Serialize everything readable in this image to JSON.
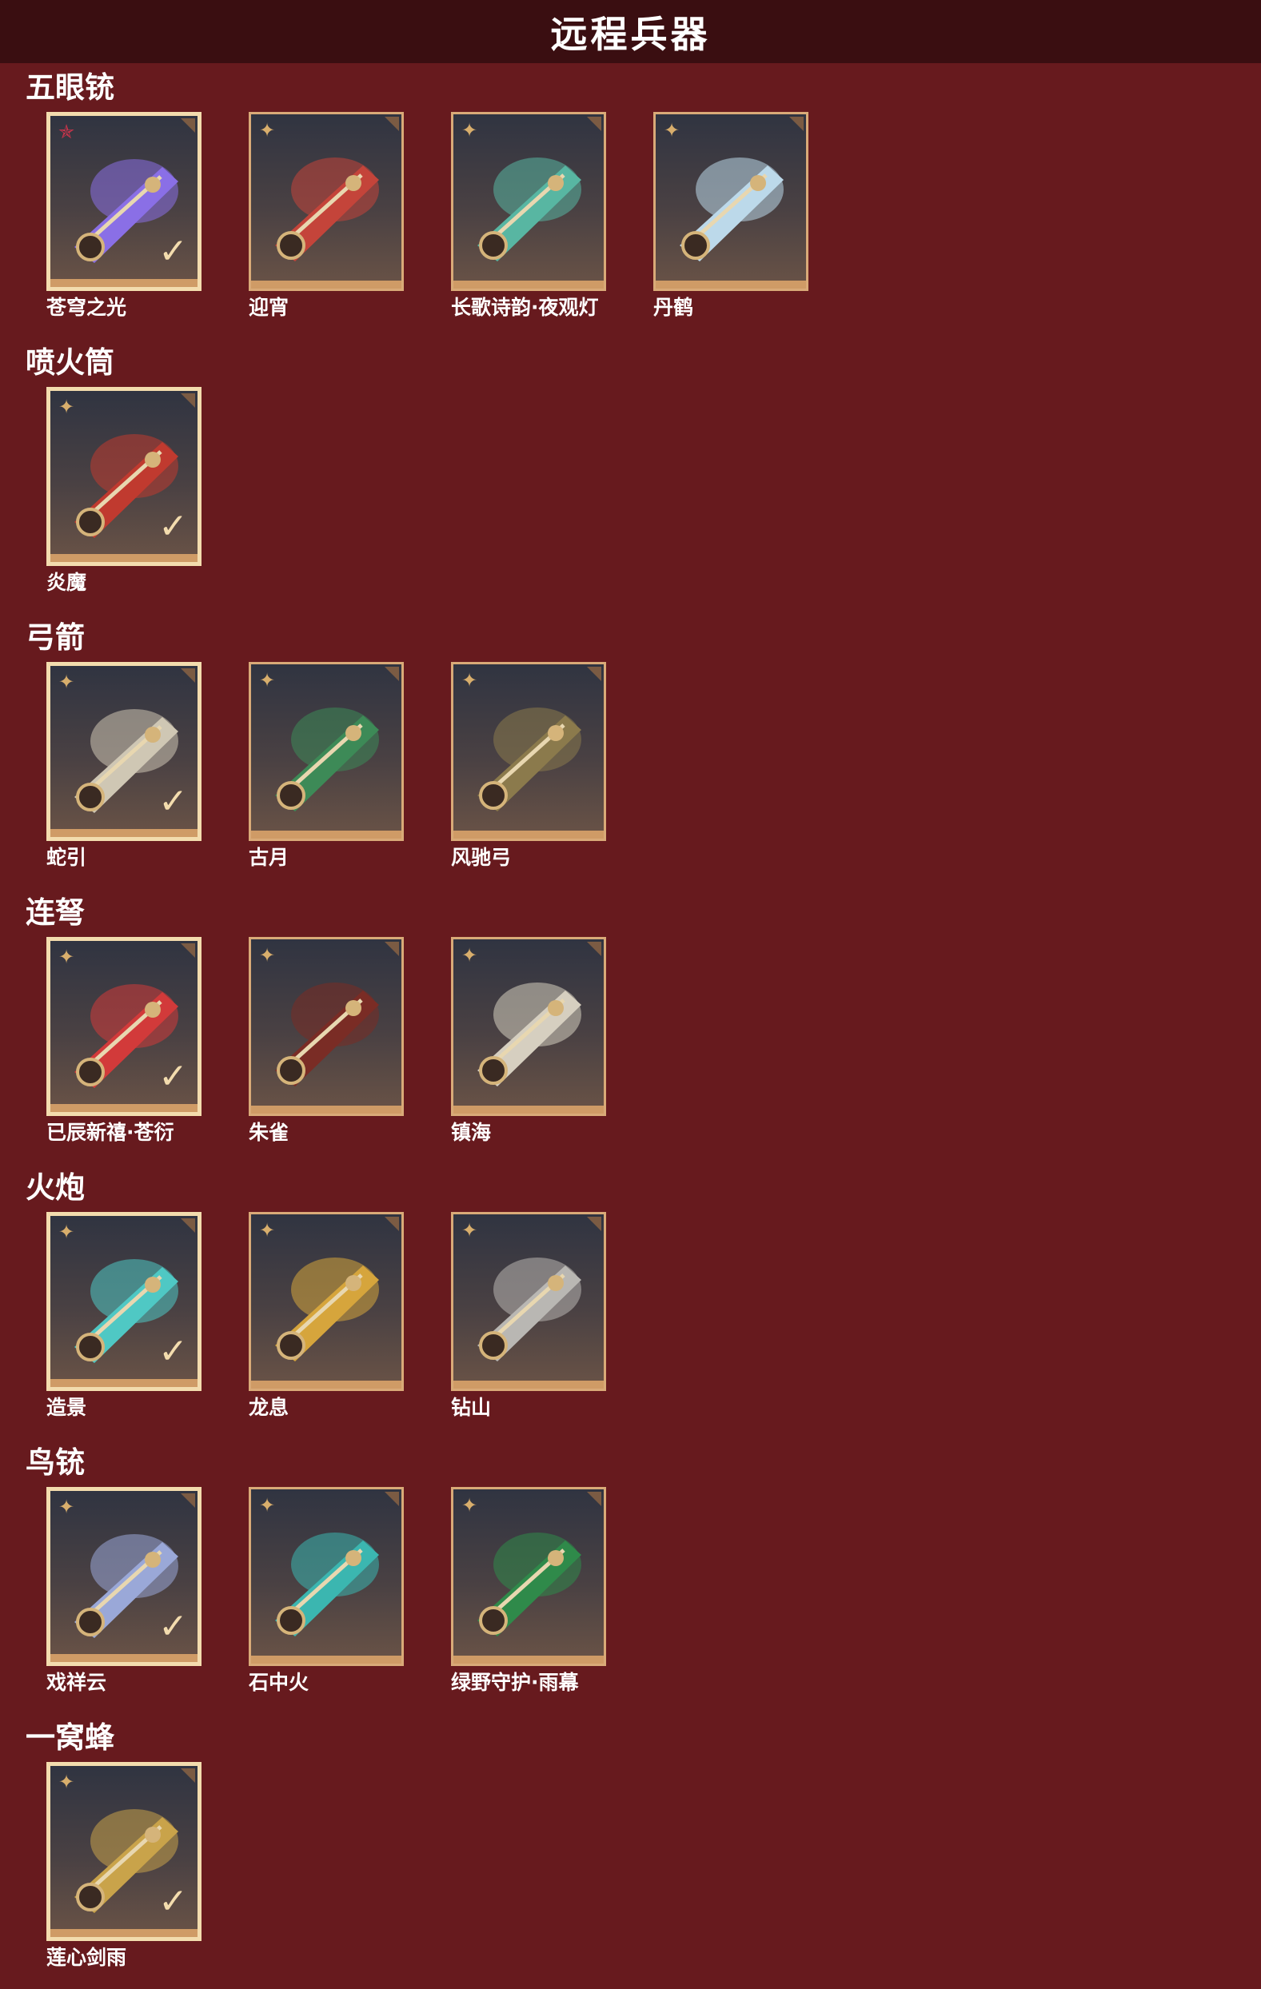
{
  "header": {
    "title": "远程兵器"
  },
  "categories": [
    {
      "name": "五眼铳",
      "items": [
        {
          "name": "苍穹之光",
          "rank_icon": "red-star-icon",
          "selected": true,
          "accent": "#8a6fe6"
        },
        {
          "name": "迎宵",
          "rank_icon": "gold-star-icon",
          "selected": false,
          "accent": "#c4443a"
        },
        {
          "name": "长歌诗韵·夜观灯",
          "rank_icon": "gold-star-icon",
          "selected": false,
          "accent": "#58b6a2"
        },
        {
          "name": "丹鹤",
          "rank_icon": "gold-star-icon",
          "selected": false,
          "accent": "#bcd9ea"
        }
      ]
    },
    {
      "name": "喷火筒",
      "items": [
        {
          "name": "炎魔",
          "rank_icon": "gold-star-icon",
          "selected": true,
          "accent": "#c03a2f"
        }
      ]
    },
    {
      "name": "弓箭",
      "items": [
        {
          "name": "蛇引",
          "rank_icon": "gold-star-icon",
          "selected": true,
          "accent": "#cfc7b4"
        },
        {
          "name": "古月",
          "rank_icon": "gold-star-icon",
          "selected": false,
          "accent": "#3d8a57"
        },
        {
          "name": "风驰弓",
          "rank_icon": "gold-star-icon",
          "selected": false,
          "accent": "#8b7a4c"
        }
      ]
    },
    {
      "name": "连弩",
      "items": [
        {
          "name": "已辰新禧·苍衍",
          "rank_icon": "gold-star-icon",
          "selected": true,
          "accent": "#d23a3a"
        },
        {
          "name": "朱雀",
          "rank_icon": "gold-star-icon",
          "selected": false,
          "accent": "#7a2c25"
        },
        {
          "name": "镇海",
          "rank_icon": "gold-star-icon",
          "selected": false,
          "accent": "#d6cfc0"
        }
      ]
    },
    {
      "name": "火炮",
      "items": [
        {
          "name": "造景",
          "rank_icon": "gold-star-icon",
          "selected": true,
          "accent": "#4fc8c4"
        },
        {
          "name": "龙息",
          "rank_icon": "gold-star-icon",
          "selected": false,
          "accent": "#d6a53c"
        },
        {
          "name": "钻山",
          "rank_icon": "gold-star-icon",
          "selected": false,
          "accent": "#b9b7b3"
        }
      ]
    },
    {
      "name": "鸟铳",
      "items": [
        {
          "name": "戏祥云",
          "rank_icon": "gold-star-icon",
          "selected": true,
          "accent": "#9aa8d8"
        },
        {
          "name": "石中火",
          "rank_icon": "gold-star-icon",
          "selected": false,
          "accent": "#3bb6b0"
        },
        {
          "name": "绿野守护·雨幕",
          "rank_icon": "gold-star-icon",
          "selected": false,
          "accent": "#2f8a4a"
        }
      ]
    },
    {
      "name": "一窝蜂",
      "items": [
        {
          "name": "莲心剑雨",
          "rank_icon": "gold-star-icon",
          "selected": true,
          "accent": "#c9a34a"
        }
      ]
    }
  ]
}
